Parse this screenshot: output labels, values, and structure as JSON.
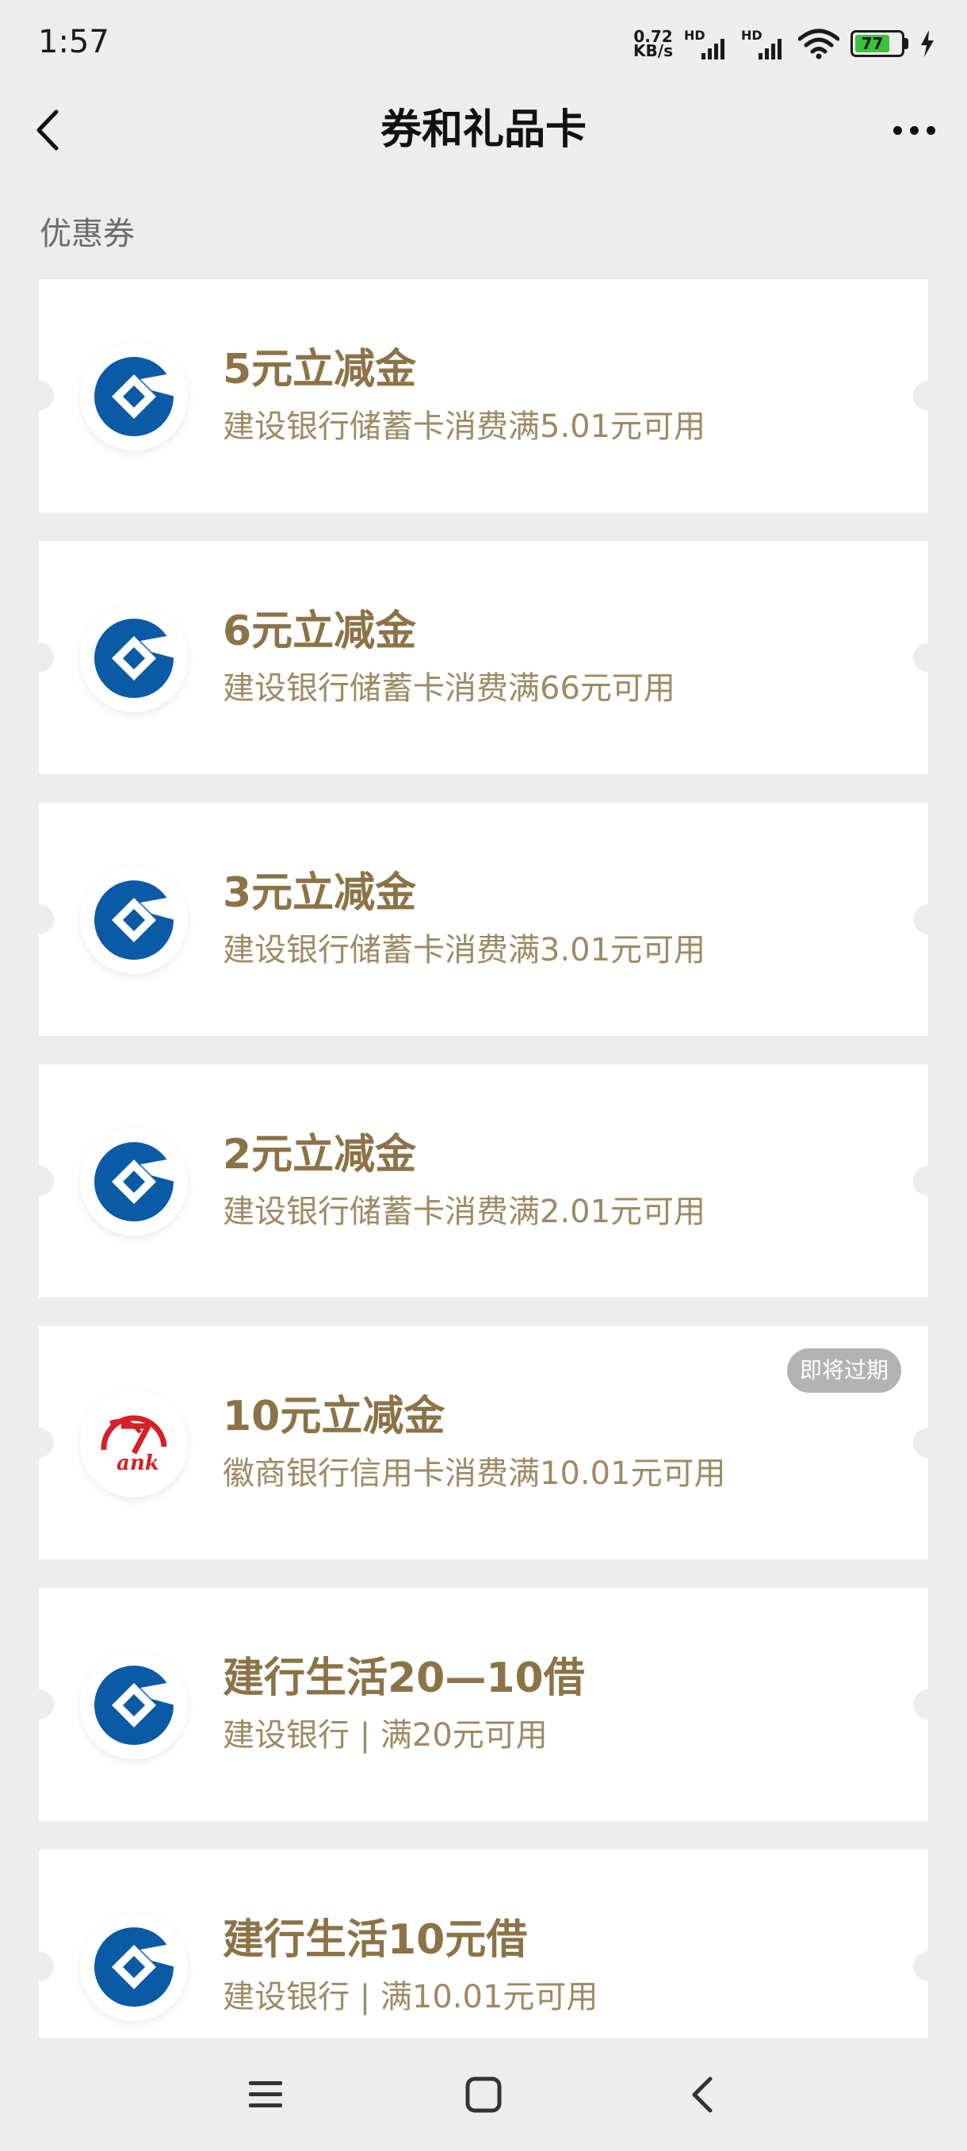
{
  "status_bar": {
    "time": "1:57",
    "net_speed_value": "0.72",
    "net_speed_unit": "KB/s",
    "sim1_label": "HD",
    "sim2_label": "HD",
    "battery_level": "77",
    "battery_color": "#3cc23c"
  },
  "nav": {
    "back_icon": "chevron-left-icon",
    "title": "券和礼品卡",
    "more_icon": "more-dots-icon"
  },
  "section_label": "优惠券",
  "colors": {
    "coupon_title": "#8c7347",
    "coupon_desc": "#9e8a64",
    "ccb_blue": "#0a5aa5",
    "hsb_red": "#d42027",
    "badge_bg": "#b3b3b3"
  },
  "coupons": [
    {
      "title": "5元立减金",
      "desc": "建设银行储蓄卡消费满5.01元可用",
      "logo": "ccb-logo",
      "badge": ""
    },
    {
      "title": "6元立减金",
      "desc": "建设银行储蓄卡消费满66元可用",
      "logo": "ccb-logo",
      "badge": ""
    },
    {
      "title": "3元立减金",
      "desc": "建设银行储蓄卡消费满3.01元可用",
      "logo": "ccb-logo",
      "badge": ""
    },
    {
      "title": "2元立减金",
      "desc": "建设银行储蓄卡消费满2.01元可用",
      "logo": "ccb-logo",
      "badge": ""
    },
    {
      "title": "10元立减金",
      "desc": "徽商银行信用卡消费满10.01元可用",
      "logo": "huishang-bank-logo",
      "logo_text": "ank",
      "badge": "即将过期"
    },
    {
      "title": "建行生活20—10借",
      "desc": "建设银行 | 满20元可用",
      "logo": "ccb-logo",
      "badge": ""
    },
    {
      "title": "建行生活10元借",
      "desc": "建设银行 | 满10.01元可用",
      "logo": "ccb-logo",
      "badge": ""
    }
  ],
  "bottom_nav": {
    "menu_icon": "menu-icon",
    "home_icon": "home-square-icon",
    "back_icon": "back-triangle-icon"
  }
}
